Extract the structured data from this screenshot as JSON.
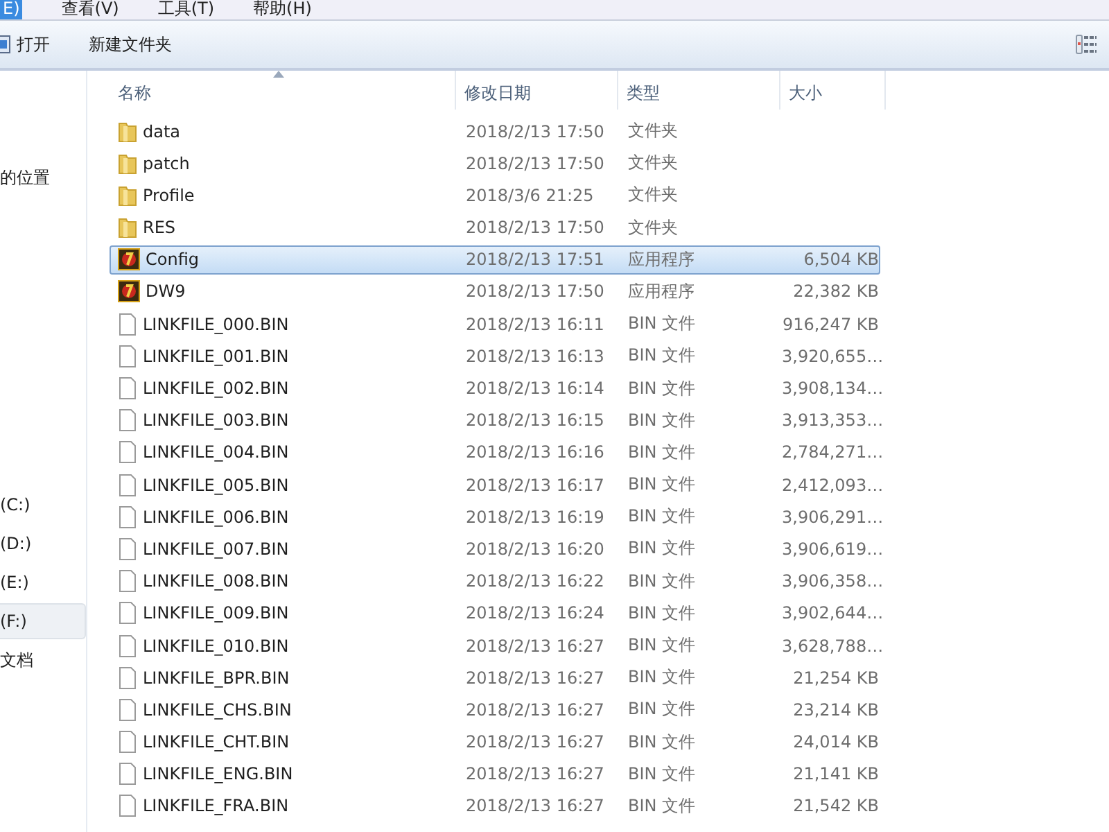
{
  "menu": [
    {
      "label": "E)",
      "selected": true
    },
    {
      "label": "查看(V)",
      "selected": false
    },
    {
      "label": "工具(T)",
      "selected": false
    },
    {
      "label": "帮助(H)",
      "selected": false
    }
  ],
  "toolbar": {
    "buttons": [
      {
        "label": "打开",
        "kind": "open"
      },
      {
        "label": "新建文件夹",
        "kind": "plain"
      }
    ]
  },
  "sidebar": {
    "items": [
      {
        "label": "的位置",
        "selected": false
      },
      {
        "label": "(C:)",
        "selected": false
      },
      {
        "label": "(D:)",
        "selected": false
      },
      {
        "label": "(E:)",
        "selected": false
      },
      {
        "label": "(F:)",
        "selected": true
      },
      {
        "label": "文档",
        "selected": false
      }
    ]
  },
  "table": {
    "columns": [
      "名称",
      "修改日期",
      "类型",
      "大小"
    ],
    "rows": [
      {
        "name": "data",
        "date": "2018/2/13 17:50",
        "type": "文件夹",
        "size": "",
        "kind": "folder",
        "selected": false
      },
      {
        "name": "patch",
        "date": "2018/2/13 17:50",
        "type": "文件夹",
        "size": "",
        "kind": "folder",
        "selected": false
      },
      {
        "name": "Profile",
        "date": "2018/3/6 21:25",
        "type": "文件夹",
        "size": "",
        "kind": "folder",
        "selected": false
      },
      {
        "name": "RES",
        "date": "2018/2/13 17:50",
        "type": "文件夹",
        "size": "",
        "kind": "folder",
        "selected": false
      },
      {
        "name": "Config",
        "date": "2018/2/13 17:51",
        "type": "应用程序",
        "size": "6,504 KB",
        "kind": "app",
        "selected": true
      },
      {
        "name": "DW9",
        "date": "2018/2/13 17:50",
        "type": "应用程序",
        "size": "22,382 KB",
        "kind": "app",
        "selected": false
      },
      {
        "name": "LINKFILE_000.BIN",
        "date": "2018/2/13 16:11",
        "type": "BIN 文件",
        "size": "916,247 KB",
        "kind": "file",
        "selected": false
      },
      {
        "name": "LINKFILE_001.BIN",
        "date": "2018/2/13 16:13",
        "type": "BIN 文件",
        "size": "3,920,655…",
        "kind": "file",
        "selected": false
      },
      {
        "name": "LINKFILE_002.BIN",
        "date": "2018/2/13 16:14",
        "type": "BIN 文件",
        "size": "3,908,134…",
        "kind": "file",
        "selected": false
      },
      {
        "name": "LINKFILE_003.BIN",
        "date": "2018/2/13 16:15",
        "type": "BIN 文件",
        "size": "3,913,353…",
        "kind": "file",
        "selected": false
      },
      {
        "name": "LINKFILE_004.BIN",
        "date": "2018/2/13 16:16",
        "type": "BIN 文件",
        "size": "2,784,271…",
        "kind": "file",
        "selected": false
      },
      {
        "name": "LINKFILE_005.BIN",
        "date": "2018/2/13 16:17",
        "type": "BIN 文件",
        "size": "2,412,093…",
        "kind": "file",
        "selected": false
      },
      {
        "name": "LINKFILE_006.BIN",
        "date": "2018/2/13 16:19",
        "type": "BIN 文件",
        "size": "3,906,291…",
        "kind": "file",
        "selected": false
      },
      {
        "name": "LINKFILE_007.BIN",
        "date": "2018/2/13 16:20",
        "type": "BIN 文件",
        "size": "3,906,619…",
        "kind": "file",
        "selected": false
      },
      {
        "name": "LINKFILE_008.BIN",
        "date": "2018/2/13 16:22",
        "type": "BIN 文件",
        "size": "3,906,358…",
        "kind": "file",
        "selected": false
      },
      {
        "name": "LINKFILE_009.BIN",
        "date": "2018/2/13 16:24",
        "type": "BIN 文件",
        "size": "3,902,644…",
        "kind": "file",
        "selected": false
      },
      {
        "name": "LINKFILE_010.BIN",
        "date": "2018/2/13 16:27",
        "type": "BIN 文件",
        "size": "3,628,788…",
        "kind": "file",
        "selected": false
      },
      {
        "name": "LINKFILE_BPR.BIN",
        "date": "2018/2/13 16:27",
        "type": "BIN 文件",
        "size": "21,254 KB",
        "kind": "file",
        "selected": false
      },
      {
        "name": "LINKFILE_CHS.BIN",
        "date": "2018/2/13 16:27",
        "type": "BIN 文件",
        "size": "23,214 KB",
        "kind": "file",
        "selected": false
      },
      {
        "name": "LINKFILE_CHT.BIN",
        "date": "2018/2/13 16:27",
        "type": "BIN 文件",
        "size": "24,014 KB",
        "kind": "file",
        "selected": false
      },
      {
        "name": "LINKFILE_ENG.BIN",
        "date": "2018/2/13 16:27",
        "type": "BIN 文件",
        "size": "21,141 KB",
        "kind": "file",
        "selected": false
      },
      {
        "name": "LINKFILE_FRA.BIN",
        "date": "2018/2/13 16:27",
        "type": "BIN 文件",
        "size": "21,542 KB",
        "kind": "file",
        "selected": false
      }
    ]
  }
}
